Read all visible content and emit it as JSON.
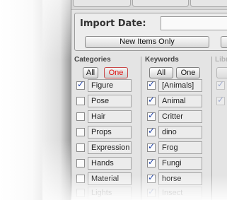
{
  "import_section": {
    "label": "Import Date:",
    "date_value": "",
    "new_items_button": "New Items Only"
  },
  "categories": {
    "header": "Categories",
    "all_button": "All",
    "one_button": "One",
    "items": [
      {
        "label": "Figure",
        "checked": true
      },
      {
        "label": "Pose",
        "checked": false
      },
      {
        "label": "Hair",
        "checked": false
      },
      {
        "label": "Props",
        "checked": false
      },
      {
        "label": "Expression",
        "checked": false
      },
      {
        "label": "Hands",
        "checked": false
      },
      {
        "label": "Material",
        "checked": false
      },
      {
        "label": "Lights",
        "checked": false
      }
    ]
  },
  "keywords": {
    "header": "Keywords",
    "all_button": "All",
    "one_button": "One",
    "items": [
      {
        "label": "[Animals]",
        "checked": true
      },
      {
        "label": "Animal",
        "checked": true
      },
      {
        "label": "Critter",
        "checked": true
      },
      {
        "label": "dino",
        "checked": true
      },
      {
        "label": "Frog",
        "checked": true
      },
      {
        "label": "Fungi",
        "checked": true
      },
      {
        "label": "horse",
        "checked": true
      },
      {
        "label": "Insect",
        "checked": true
      }
    ]
  },
  "libraries": {
    "header": "Libr"
  },
  "colors": {
    "active_button_text": "#e01010",
    "checkmark": "#1c3fa8"
  }
}
